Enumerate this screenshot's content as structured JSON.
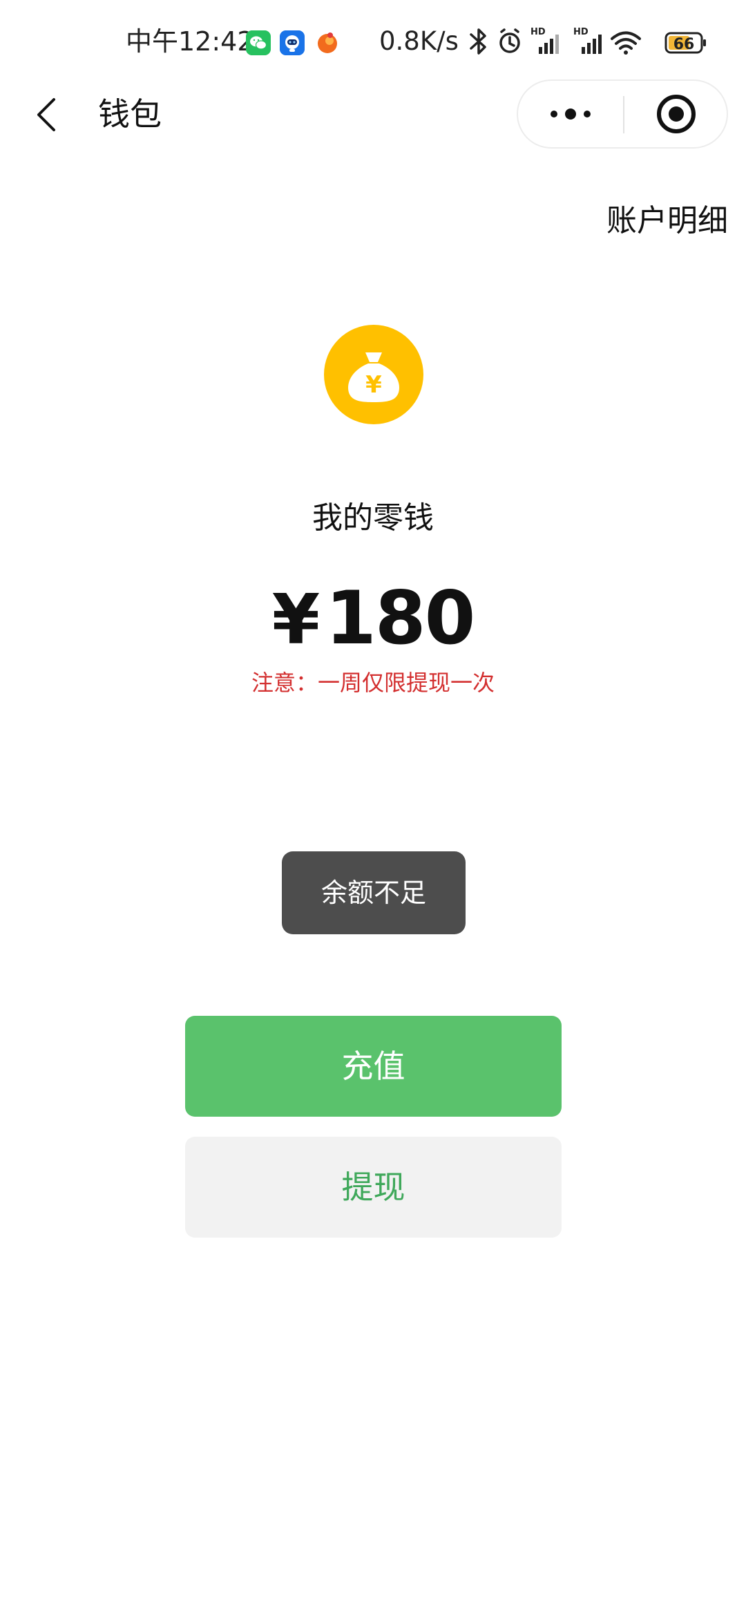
{
  "status_bar": {
    "time": "中午12:42",
    "net_speed": "0.8K/s",
    "battery": "66",
    "notification_icons": [
      "wechat-icon",
      "robot-app-icon",
      "orange-app-icon"
    ],
    "system_icons": [
      "bluetooth-icon",
      "alarm-icon",
      "hd-signal-icon",
      "hd-signal-icon",
      "wifi-icon",
      "battery-icon"
    ]
  },
  "title_bar": {
    "title": "钱包",
    "back_icon": "chevron-left-icon",
    "more_icon": "more-dots-icon",
    "close_icon": "target-close-icon"
  },
  "header_link": "账户明细",
  "wallet": {
    "logo_icon": "money-bag-icon",
    "label": "我的零钱",
    "currency": "¥",
    "amount": "180",
    "notice": "注意：一周仅限提现一次"
  },
  "toast": "余额不足",
  "buttons": {
    "recharge": "充值",
    "withdraw": "提现"
  },
  "colors": {
    "primary_green": "#5ac26c",
    "withdraw_text_green": "#3fa85a",
    "notice_red": "#d32f2f",
    "toast_bg": "#4d4d4d",
    "logo_yellow": "#ffc000"
  }
}
